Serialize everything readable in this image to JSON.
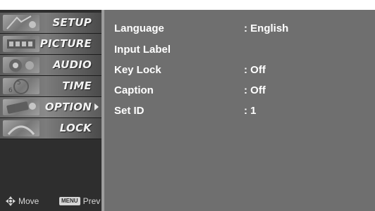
{
  "sidebar": {
    "items": [
      {
        "label": "SETUP"
      },
      {
        "label": "PICTURE"
      },
      {
        "label": "AUDIO"
      },
      {
        "label": "TIME"
      },
      {
        "label": "OPTION",
        "selected": true
      },
      {
        "label": "LOCK"
      }
    ],
    "footer": {
      "move_label": "Move",
      "menu_key": "MENU",
      "prev_label": "Prev"
    }
  },
  "options": [
    {
      "label": "Language",
      "value": ": English"
    },
    {
      "label": "Input Label",
      "value": ""
    },
    {
      "label": "Key Lock",
      "value": ": Off"
    },
    {
      "label": "Caption",
      "value": ": Off"
    },
    {
      "label": "Set ID",
      "value": ": 1"
    }
  ],
  "colors": {
    "panel": "#6f6f6f",
    "sidebar": "#2e2e2e",
    "text": "#ffffff"
  }
}
